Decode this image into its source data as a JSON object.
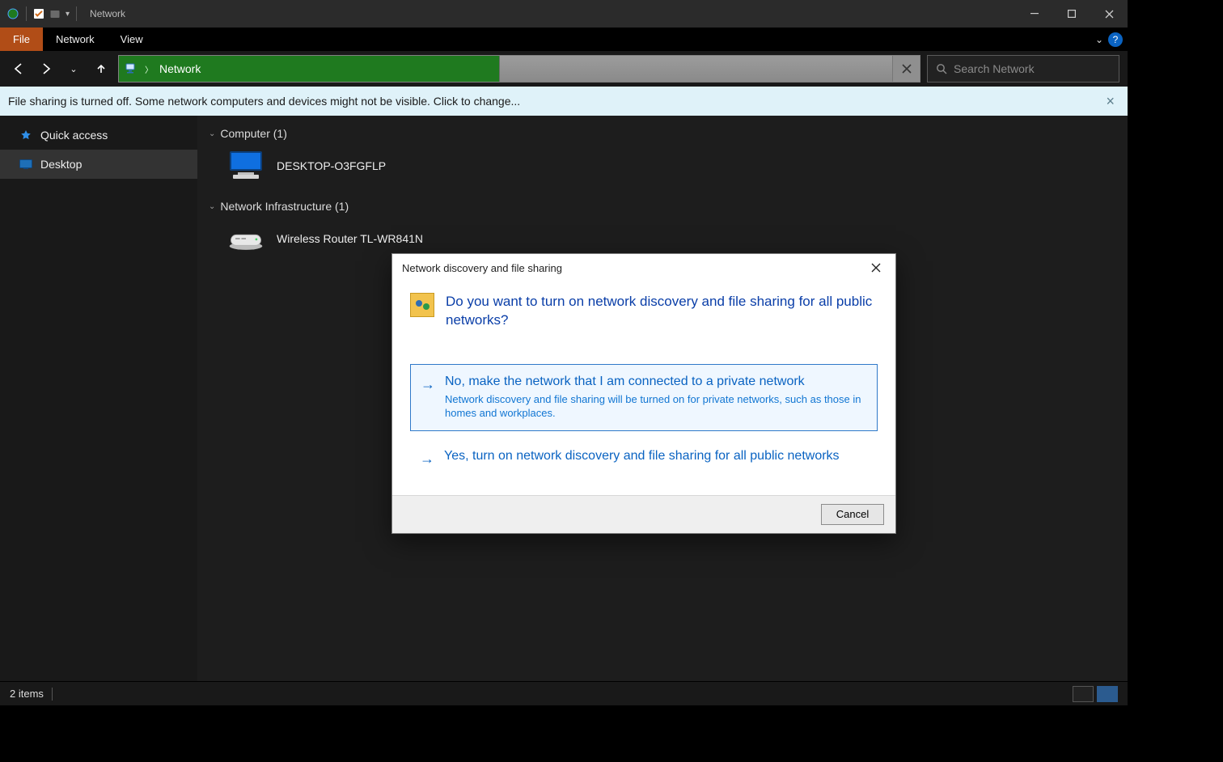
{
  "titlebar": {
    "title": "Network"
  },
  "ribbon": {
    "file": "File",
    "tabs": [
      "Network",
      "View"
    ]
  },
  "nav": {
    "address_label": "Network",
    "search_placeholder": "Search Network"
  },
  "infobar": {
    "text": "File sharing is turned off. Some network computers and devices might not be visible. Click to change..."
  },
  "sidebar": {
    "quick_access": "Quick access",
    "desktop": "Desktop"
  },
  "content": {
    "group_computer": {
      "label": "Computer (1)",
      "items": [
        "DESKTOP-O3FGFLP"
      ]
    },
    "group_network_infra": {
      "label": "Network Infrastructure (1)",
      "items": [
        "Wireless Router TL-WR841N"
      ]
    }
  },
  "status": {
    "text": "2 items"
  },
  "dialog": {
    "title": "Network discovery and file sharing",
    "hero": "Do you want to turn on network discovery and file sharing for all public networks?",
    "opt1_title": "No, make the network that I am connected to a private network",
    "opt1_sub": "Network discovery and file sharing will be turned on for private networks, such as those in homes and workplaces.",
    "opt2_title": "Yes, turn on network discovery and file sharing for all public networks",
    "cancel": "Cancel"
  }
}
